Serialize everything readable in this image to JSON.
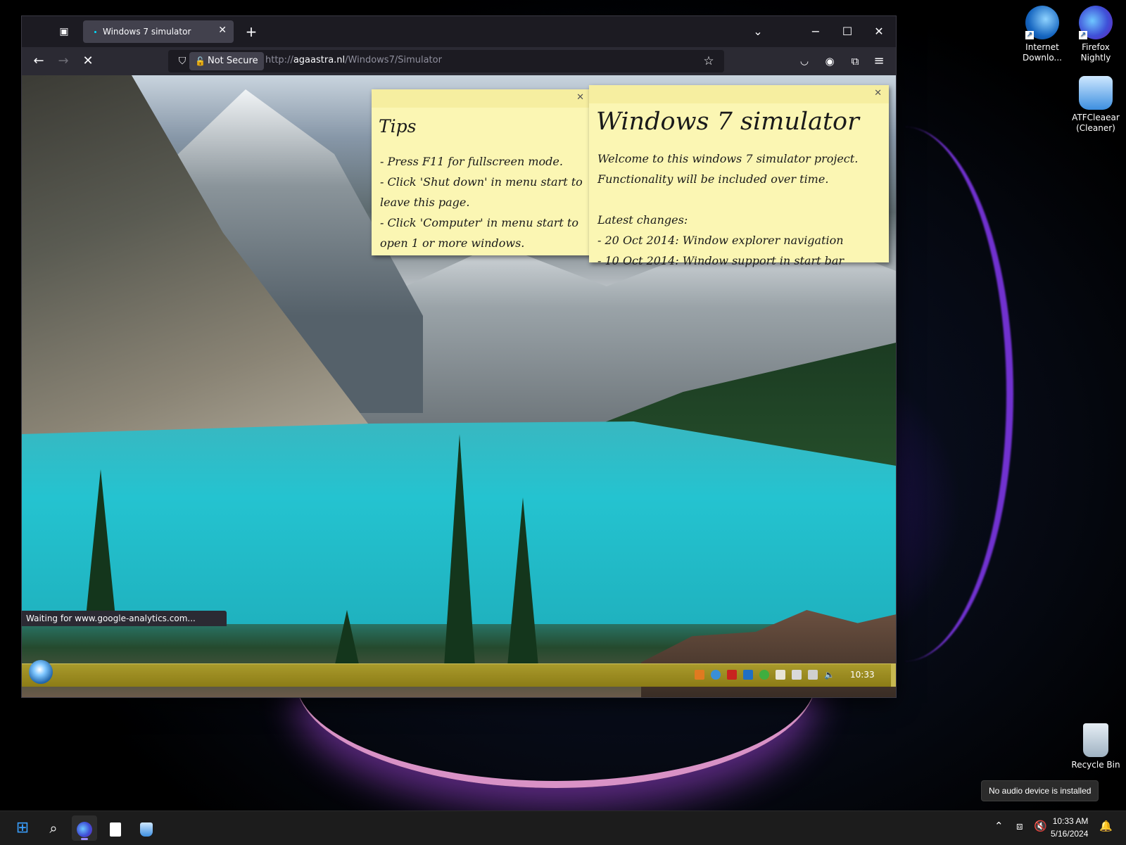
{
  "browser": {
    "tab_title": "Windows 7 simulator",
    "url_security": "Not Secure",
    "url_prefix": "http://",
    "url_domain": "agaastra.nl",
    "url_path": "/Windows7/Simulator",
    "status_text": "Waiting for www.google-analytics.com..."
  },
  "page": {
    "tips_title": "Tips",
    "tips_lines": [
      "- Press F11 for fullscreen mode.",
      "- Click 'Shut down' in menu start to leave this page.",
      "- Click 'Computer' in menu start to open 1 or more windows."
    ],
    "w7_title": "Windows 7 simulator",
    "w7_lines": [
      "Welcome to this windows 7 simulator project.",
      "Functionality will be included over time.",
      "",
      "Latest changes:",
      "- 20 Oct 2014: Window explorer navigation",
      "- 10 Oct 2014: Window support in start bar"
    ],
    "w7_clock": "10:33"
  },
  "desktop": {
    "icons": [
      {
        "label": "Internet Downlo...",
        "icon": "idm-icon"
      },
      {
        "label": "Firefox Nightly",
        "icon": "firefox-nightly-icon"
      },
      {
        "label": "ATFCleaear (Cleaner)",
        "icon": "atf-cleaner-icon"
      },
      {
        "label": "Recycle Bin",
        "icon": "recycle-bin-icon"
      }
    ],
    "toast": "No audio device is installed"
  },
  "taskbar": {
    "time": "10:33 AM",
    "date": "5/16/2024"
  },
  "colors": {
    "note": "#fbf6b3",
    "win7_taskbar": "#a99a2c",
    "browser_bg": "#1c1b22"
  }
}
